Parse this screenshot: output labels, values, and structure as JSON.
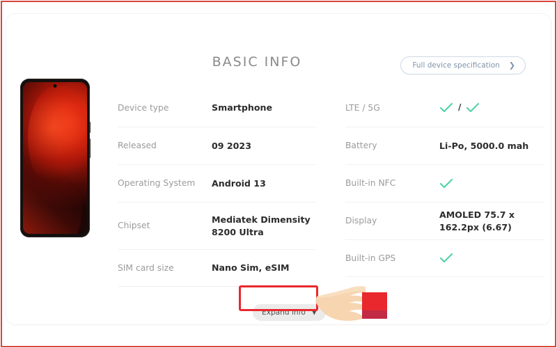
{
  "card": {
    "header": {
      "title": "BASIC INFO",
      "full_spec_label": "Full device specification",
      "full_spec_chevron": "chevron-right-icon"
    },
    "device_image_alt": "smartphone-front-view",
    "left_specs": [
      {
        "label": "Device type",
        "value": "Smartphone"
      },
      {
        "label": "Released",
        "value": "09 2023"
      },
      {
        "label": "Operating System",
        "value": "Android 13"
      },
      {
        "label": "Chipset",
        "value": "Mediatek Dimensity 8200 Ultra"
      },
      {
        "label": "SIM card size",
        "value": "Nano Sim, eSIM"
      }
    ],
    "right_specs": [
      {
        "label": "LTE / 5G",
        "value": "",
        "type": "double-check",
        "separator": "/"
      },
      {
        "label": "Battery",
        "value": "Li-Po, 5000.0 mah",
        "type": "text"
      },
      {
        "label": "Built-in NFC",
        "value": "",
        "type": "check"
      },
      {
        "label": "Display",
        "value": "AMOLED 75.7 x 162.2px (6.67)",
        "type": "text"
      },
      {
        "label": "Built-in GPS",
        "value": "",
        "type": "check"
      }
    ],
    "footer": {
      "expand_label": "Expand info",
      "expand_chevron": "chevron-down-icon"
    }
  },
  "annotations": {
    "page_border_color": "#d8453c",
    "highlight_color": "#e8282d",
    "cursor": "pointing-hand-cursor"
  },
  "colors": {
    "check_green": "#4ed3a6",
    "label_gray": "#9b9b9b",
    "value_dark": "#2c2c2c",
    "title_gray": "#8a8a8a",
    "link_blue_gray": "#7f93a8",
    "button_gray": "#ebebeb",
    "sleeve_red": "#e8282d",
    "sleeve_dark_red": "#c22a45",
    "skin": "#f6d5b0"
  }
}
